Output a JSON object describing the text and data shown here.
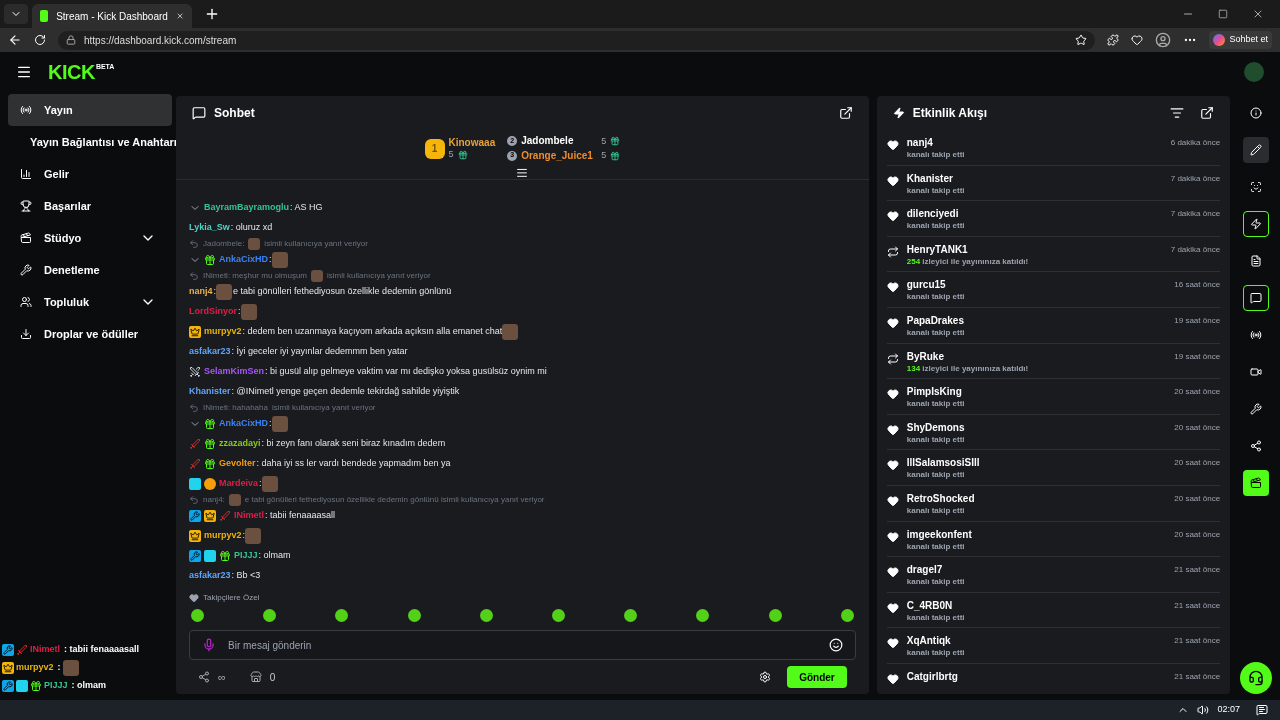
{
  "browser": {
    "tab_title": "Stream - Kick Dashboard",
    "url": "https://dashboard.kick.com/stream",
    "copilot_label": "Sohbet et"
  },
  "header": {
    "logo": "KICK",
    "logo_badge": "BETA"
  },
  "sidebar": {
    "items": [
      {
        "label": "Yayın",
        "selected": true
      },
      {
        "label": "Yayın Bağlantısı ve Anahtarı",
        "selected": false,
        "kind": "sub"
      },
      {
        "label": "Gelir",
        "selected": false
      },
      {
        "label": "Başarılar",
        "selected": false
      },
      {
        "label": "Stüdyo",
        "selected": false,
        "expanded": false
      },
      {
        "label": "Denetleme",
        "selected": false
      },
      {
        "label": "Topluluk",
        "selected": false,
        "expanded": false
      },
      {
        "label": "Droplar ve ödüller",
        "selected": false
      }
    ]
  },
  "chat": {
    "title": "Sohbet",
    "leaders": [
      {
        "rank": "1",
        "name": "Kinowaaa",
        "count": "5",
        "color": "#e6a23c"
      },
      {
        "rank": "2",
        "name": "Jadombele",
        "count": "5",
        "color": "#ffffff"
      },
      {
        "rank": "3",
        "name": "Orange_Juice1",
        "count": "5",
        "color": "#f08c2a"
      }
    ],
    "messages": [
      {
        "kind": "message",
        "badges": [
          {
            "kind": "collapse"
          }
        ],
        "user": "BayramBayramoglu",
        "color": "#34c38f",
        "parts": [
          {
            "kind": "text",
            "value": ": AS HG"
          }
        ]
      },
      {
        "kind": "message",
        "user": "Lykia_Sw",
        "color": "#4fd1c5",
        "parts": [
          {
            "kind": "text",
            "value": ": oluruz xd"
          }
        ]
      },
      {
        "kind": "reply",
        "user": "Jadombele:",
        "parts": [
          {
            "kind": "emote"
          },
          {
            "kind": "text",
            "value": "isimli kullanıcıya yanıt veriyor"
          }
        ]
      },
      {
        "kind": "message",
        "badges": [
          {
            "kind": "collapse"
          },
          {
            "kind": "gifter"
          }
        ],
        "user": "AnkaCixHD",
        "color": "#3b82f6",
        "parts": [
          {
            "kind": "text",
            "value": ":"
          },
          {
            "kind": "emote"
          }
        ]
      },
      {
        "kind": "reply",
        "user": "INimetl: meşhur mu olmuşum",
        "parts": [
          {
            "kind": "emote"
          },
          {
            "kind": "text",
            "value": "isimli kullanıcıya yanıt veriyor"
          }
        ]
      },
      {
        "kind": "message",
        "user": "nanj4",
        "color": "#e8b04a",
        "parts": [
          {
            "kind": "text",
            "value": ":"
          },
          {
            "kind": "emote"
          },
          {
            "kind": "text",
            "value": "e tabi gönülleri fethediyosun özellikle dedemin gönlünü"
          }
        ]
      },
      {
        "kind": "message",
        "user": "LordSinyor",
        "color": "#e11d48",
        "parts": [
          {
            "kind": "text",
            "value": ":"
          },
          {
            "kind": "emote"
          }
        ]
      },
      {
        "kind": "message",
        "badges": [
          {
            "kind": "vip"
          }
        ],
        "user": "murpyv2",
        "color": "#eab308",
        "parts": [
          {
            "kind": "text",
            "value": ": dedem ben uzanmaya kaçıyom arkada açıksın alla emanet chat"
          },
          {
            "kind": "emote"
          }
        ]
      },
      {
        "kind": "message",
        "user": "asfakar23",
        "color": "#60a5fa",
        "parts": [
          {
            "kind": "text",
            "value": ": İyi geceler iyi yayınlar dedemmm ben yatar"
          }
        ]
      },
      {
        "kind": "message",
        "badges": [
          {
            "kind": "swords"
          }
        ],
        "user": "SelamKimSen",
        "color": "#a855f7",
        "parts": [
          {
            "kind": "text",
            "value": ": bi gusül alıp gelmeye vaktim var mı dedişko yoksa gusülsüz oynim mi"
          }
        ]
      },
      {
        "kind": "message",
        "user": "Khanister",
        "color": "#60a5fa",
        "parts": [
          {
            "kind": "text",
            "value": ": @INimetl yenge geçen dedemle tekirdağ sahilde yiyiştik"
          }
        ]
      },
      {
        "kind": "reply",
        "user": "INimetl: hahahaha",
        "parts": [
          {
            "kind": "text",
            "value": "isimli kullanıcıya yanıt veriyor"
          }
        ]
      },
      {
        "kind": "message",
        "badges": [
          {
            "kind": "collapse"
          },
          {
            "kind": "gifter"
          }
        ],
        "user": "AnkaCixHD",
        "color": "#3b82f6",
        "parts": [
          {
            "kind": "text",
            "value": ":"
          },
          {
            "kind": "emote"
          }
        ]
      },
      {
        "kind": "message",
        "badges": [
          {
            "kind": "sword"
          },
          {
            "kind": "gifter"
          }
        ],
        "user": "zzazadayi",
        "color": "#84cc16",
        "parts": [
          {
            "kind": "text",
            "value": ": bi zeyn fanı olarak seni biraz kınadım dedem"
          }
        ]
      },
      {
        "kind": "message",
        "badges": [
          {
            "kind": "sword"
          },
          {
            "kind": "gifter"
          }
        ],
        "user": "Gevolter",
        "color": "#f59e0b",
        "parts": [
          {
            "kind": "text",
            "value": ": daha iyi ss ler vardı bendede yapmadım ben ya"
          }
        ]
      },
      {
        "kind": "message",
        "badges": [
          {
            "kind": "og"
          },
          {
            "kind": "founder"
          }
        ],
        "user": "Mardeiva",
        "color": "#e11d48",
        "parts": [
          {
            "kind": "text",
            "value": ":"
          },
          {
            "kind": "emote"
          }
        ]
      },
      {
        "kind": "reply",
        "user": "nanj4:",
        "parts": [
          {
            "kind": "emote"
          },
          {
            "kind": "text",
            "value": "e tabi gönülleri fethediyosun özellikle dedemin gönlünü isimli kullanıcıya yanıt veriyor"
          }
        ]
      },
      {
        "kind": "message",
        "badges": [
          {
            "kind": "moderator"
          },
          {
            "kind": "vip"
          },
          {
            "kind": "sword"
          }
        ],
        "user": "INimetl",
        "color": "#e11d48",
        "parts": [
          {
            "kind": "text",
            "value": ": tabii fenaaaasall"
          }
        ]
      },
      {
        "kind": "message",
        "badges": [
          {
            "kind": "vip"
          }
        ],
        "user": "murpyv2",
        "color": "#eab308",
        "parts": [
          {
            "kind": "text",
            "value": ":"
          },
          {
            "kind": "emote"
          }
        ]
      },
      {
        "kind": "message",
        "badges": [
          {
            "kind": "moderator"
          },
          {
            "kind": "og"
          },
          {
            "kind": "gifter"
          }
        ],
        "user": "PIJJJ",
        "color": "#34c38f",
        "parts": [
          {
            "kind": "text",
            "value": ": olmam"
          }
        ]
      },
      {
        "kind": "message",
        "user": "asfakar23",
        "color": "#60a5fa",
        "parts": [
          {
            "kind": "text",
            "value": ": Bb <3"
          }
        ]
      }
    ],
    "emote_bar": {
      "label": "Takipçilere Özel"
    },
    "input": {
      "placeholder": "Bir mesaj gönderin"
    },
    "footer": {
      "slow_mode": "∞",
      "count": "0",
      "send_label": "Gönder"
    }
  },
  "activity": {
    "title": "Etkinlik Akışı",
    "items": [
      {
        "kind": "follow",
        "name": "nanj4",
        "detail": "kanalı takip etti",
        "time": "6 dakika önce"
      },
      {
        "kind": "follow",
        "name": "Khanister",
        "detail": "kanalı takip etti",
        "time": "7 dakika önce"
      },
      {
        "kind": "follow",
        "name": "dilenciyedi",
        "detail": "kanalı takip etti",
        "time": "7 dakika önce"
      },
      {
        "kind": "host",
        "name": "HenryTANK1",
        "viewers": "254",
        "detail": "izleyici ile yayınınıza katıldı!",
        "time": "7 dakika önce"
      },
      {
        "kind": "follow",
        "name": "gurcu15",
        "detail": "kanalı takip etti",
        "time": "16 saat önce"
      },
      {
        "kind": "follow",
        "name": "PapaDrakes",
        "detail": "kanalı takip etti",
        "time": "19 saat önce"
      },
      {
        "kind": "host",
        "name": "ByRuke",
        "viewers": "134",
        "detail": "izleyici ile yayınınıza katıldı!",
        "time": "19 saat önce"
      },
      {
        "kind": "follow",
        "name": "PimpIsKing",
        "detail": "kanalı takip etti",
        "time": "20 saat önce"
      },
      {
        "kind": "follow",
        "name": "ShyDemons",
        "detail": "kanalı takip etti",
        "time": "20 saat önce"
      },
      {
        "kind": "follow",
        "name": "IllSalamsosiSIll",
        "detail": "kanalı takip etti",
        "time": "20 saat önce"
      },
      {
        "kind": "follow",
        "name": "RetroShocked",
        "detail": "kanalı takip etti",
        "time": "20 saat önce"
      },
      {
        "kind": "follow",
        "name": "imgeekonfent",
        "detail": "kanalı takip etti",
        "time": "20 saat önce"
      },
      {
        "kind": "follow",
        "name": "dragel7",
        "detail": "kanalı takip etti",
        "time": "21 saat önce"
      },
      {
        "kind": "follow",
        "name": "C_4RB0N",
        "detail": "kanalı takip etti",
        "time": "21 saat önce"
      },
      {
        "kind": "follow",
        "name": "XqAntiqk",
        "detail": "kanalı takip etti",
        "time": "21 saat önce"
      },
      {
        "kind": "follow",
        "name": "Catgirlbrtg",
        "time": "21 saat önce"
      }
    ]
  },
  "rail": [
    {
      "kind": "plain"
    },
    {
      "kind": "muted"
    },
    {
      "kind": "plain"
    },
    {
      "kind": "outlined"
    },
    {
      "kind": "plain"
    },
    {
      "kind": "outlined"
    },
    {
      "kind": "plain"
    },
    {
      "kind": "plain"
    },
    {
      "kind": "plain"
    },
    {
      "kind": "plain"
    },
    {
      "kind": "filled"
    }
  ],
  "overlay": [
    {
      "badges": [
        {
          "kind": "moderator"
        },
        {
          "kind": "sword"
        }
      ],
      "user": "INimetl",
      "color": "#e11d48",
      "parts": [
        {
          "kind": "text",
          "value": ": tabii fenaaaasall"
        }
      ]
    },
    {
      "badges": [
        {
          "kind": "vip"
        }
      ],
      "user": "murpyv2",
      "color": "#eab308",
      "parts": [
        {
          "kind": "text",
          "value": ":"
        },
        {
          "kind": "emote"
        }
      ]
    },
    {
      "badges": [
        {
          "kind": "moderator"
        },
        {
          "kind": "og"
        },
        {
          "kind": "gifter"
        }
      ],
      "user": "PIJJJ",
      "color": "#34c38f",
      "parts": [
        {
          "kind": "text",
          "value": ": olmam"
        }
      ]
    }
  ],
  "taskbar": {
    "time": "02:07"
  }
}
